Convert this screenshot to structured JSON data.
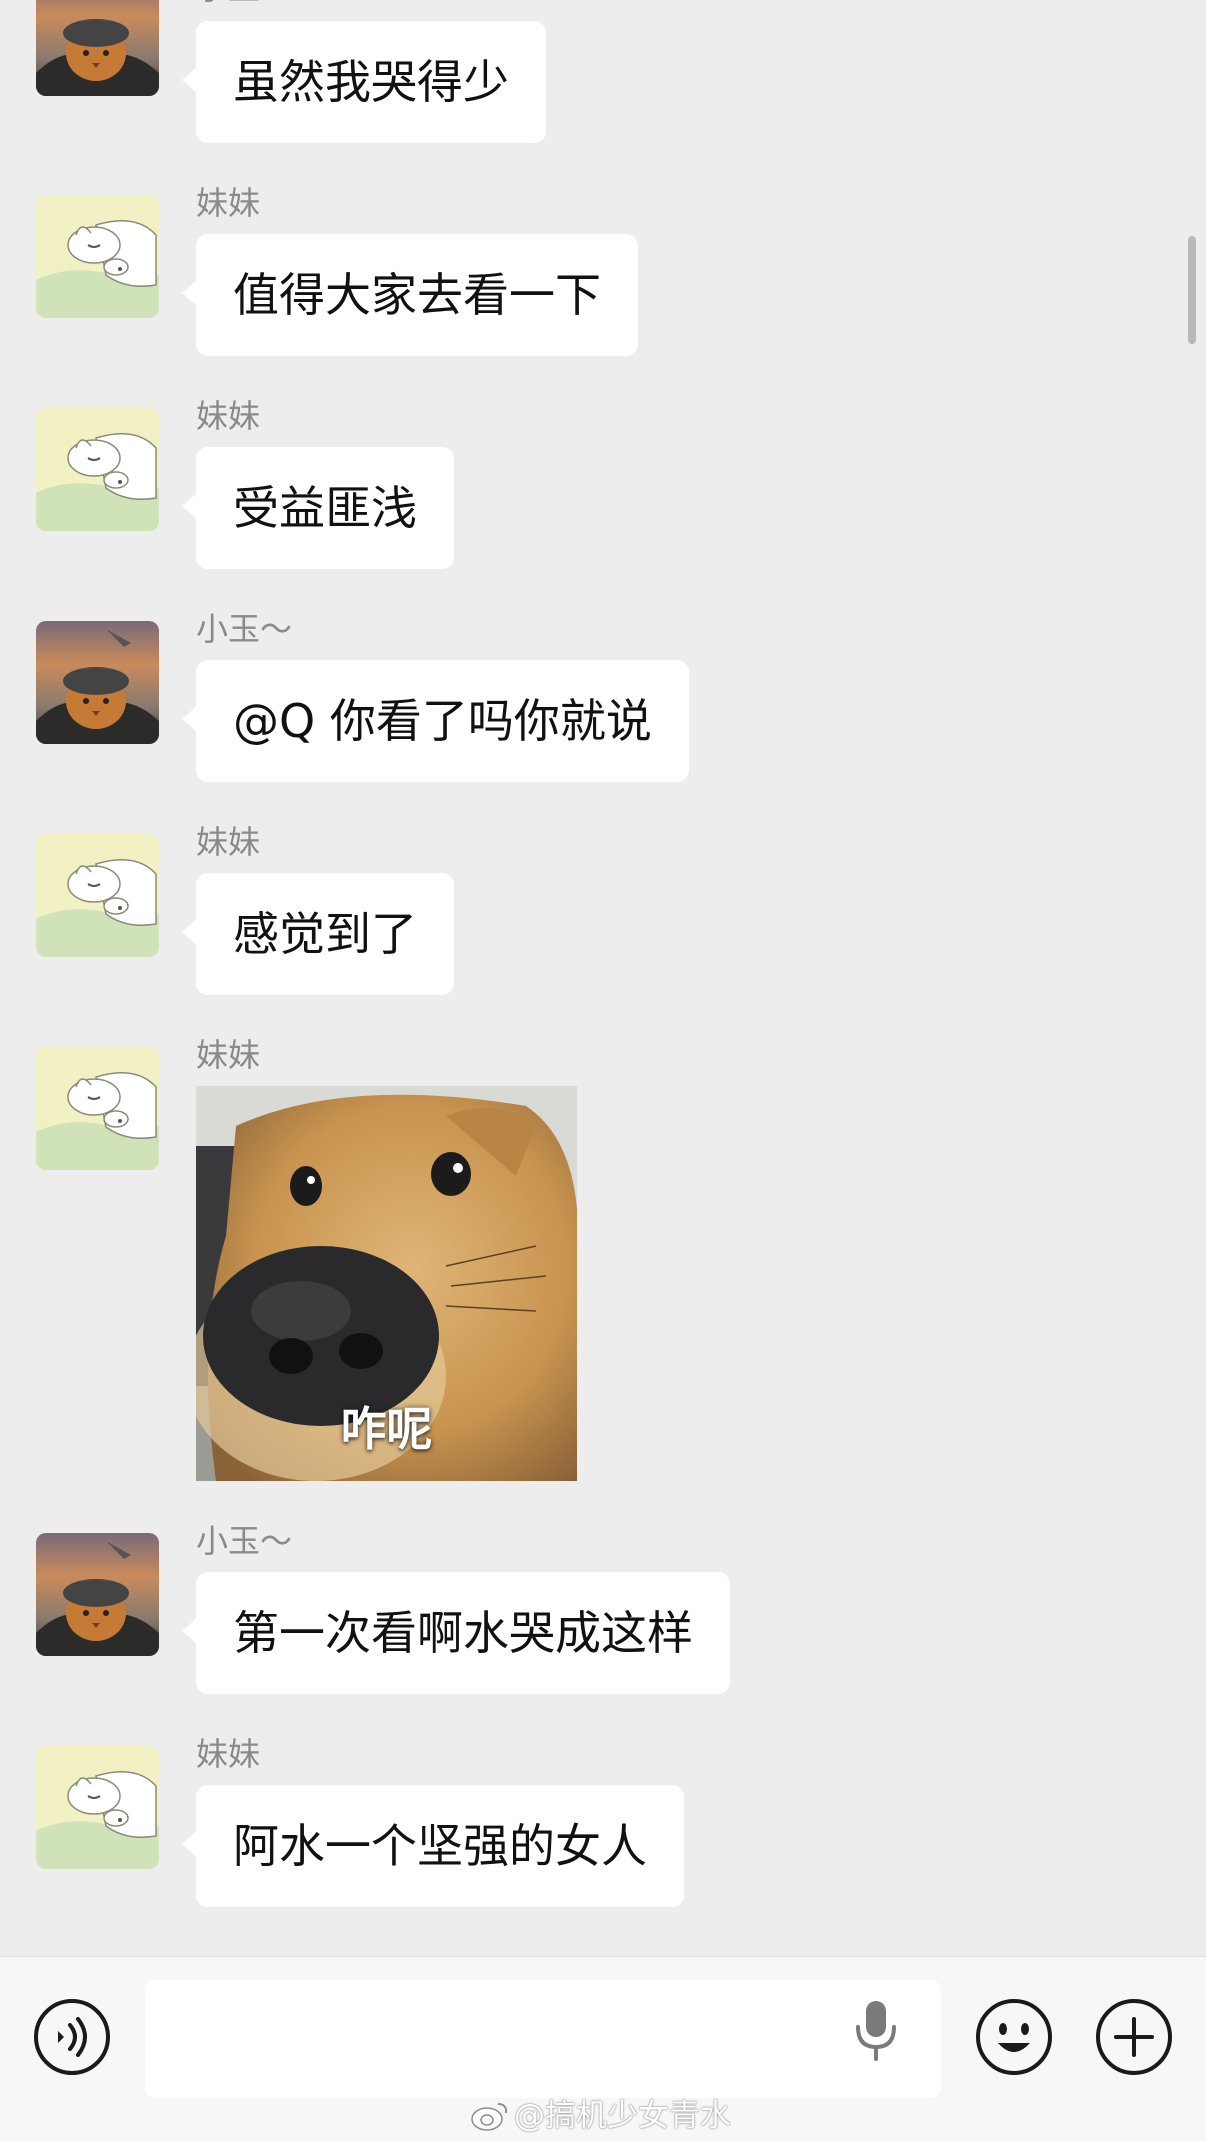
{
  "messages": [
    {
      "sender": "小玉～",
      "avatar": "cat-pilot-avatar",
      "text": "虽然我哭得少"
    },
    {
      "sender": "妹妹",
      "avatar": "sleeping-dog-avatar",
      "text": "值得大家去看一下"
    },
    {
      "sender": "妹妹",
      "avatar": "sleeping-dog-avatar",
      "text": "受益匪浅"
    },
    {
      "sender": "小玉～",
      "avatar": "cat-pilot-avatar",
      "text": "@Q 你看了吗你就说"
    },
    {
      "sender": "妹妹",
      "avatar": "sleeping-dog-avatar",
      "text": "感觉到了"
    },
    {
      "sender": "妹妹",
      "avatar": "sleeping-dog-avatar",
      "sticker_caption": "咋呢"
    },
    {
      "sender": "小玉～",
      "avatar": "cat-pilot-avatar",
      "text": "第一次看啊水哭成这样"
    },
    {
      "sender": "妹妹",
      "avatar": "sleeping-dog-avatar",
      "text": "阿水一个坚强的女人"
    }
  ],
  "input_bar": {
    "voice_icon": "voice-icon",
    "mic_icon": "microphone-icon",
    "emoji_icon": "emoji-icon",
    "plus_icon": "plus-icon"
  },
  "watermark": {
    "text": "@搞机少女青水",
    "icon": "weibo-icon"
  },
  "colors": {
    "background": "#ededed",
    "bubble": "#ffffff",
    "sender_name": "#8a8a8a",
    "input_bar": "#f7f7f7"
  }
}
